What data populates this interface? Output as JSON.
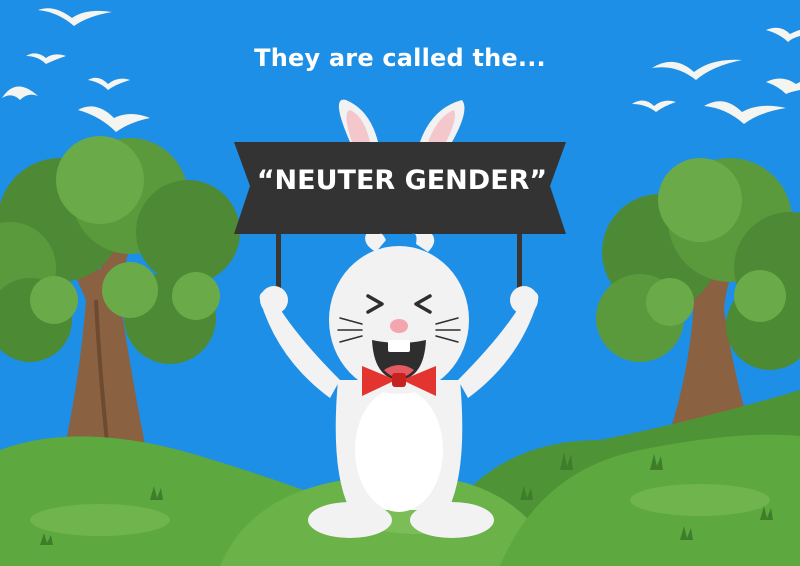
{
  "headline": "They are called the...",
  "banner": {
    "text": "“NEUTER GENDER”"
  },
  "colors": {
    "sky": "#1E8FE6",
    "banner": "#333333",
    "bow_tie": "#E3342F",
    "grass": "#5DA83F"
  }
}
